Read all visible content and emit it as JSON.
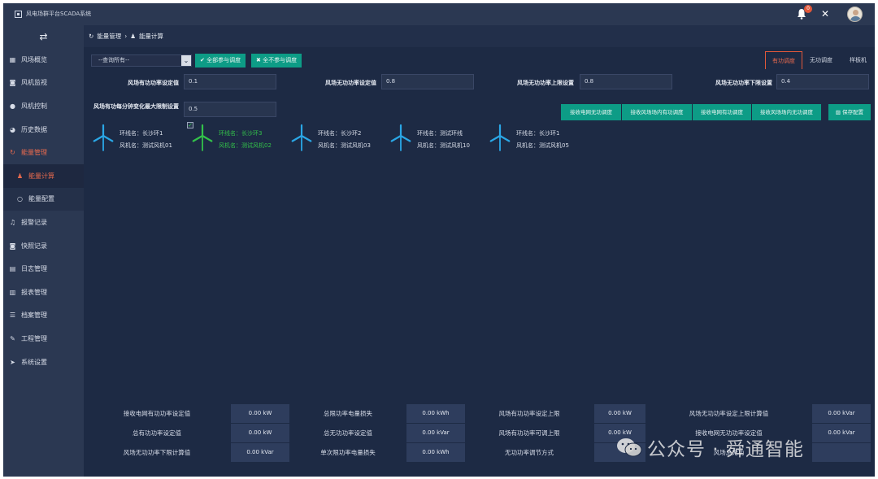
{
  "app": {
    "title": "风电场群平台SCADA系统",
    "notification_count": "0"
  },
  "sidebar": {
    "items": [
      {
        "label": "风场概览",
        "icon": "grid-icon"
      },
      {
        "label": "风机监视",
        "icon": "camera-icon"
      },
      {
        "label": "风机控制",
        "icon": "circle-icon"
      },
      {
        "label": "历史数据",
        "icon": "pie-icon"
      },
      {
        "label": "能量管理",
        "icon": "refresh-icon"
      },
      {
        "label": "能量计算",
        "icon": "user-icon"
      },
      {
        "label": "能量配置",
        "icon": "ring-icon"
      },
      {
        "label": "报警记录",
        "icon": "bell-icon"
      },
      {
        "label": "快照记录",
        "icon": "camera-icon"
      },
      {
        "label": "日志管理",
        "icon": "file-icon"
      },
      {
        "label": "报表管理",
        "icon": "table-icon"
      },
      {
        "label": "档案管理",
        "icon": "list-icon"
      },
      {
        "label": "工程管理",
        "icon": "wrench-icon"
      },
      {
        "label": "系统设置",
        "icon": "send-icon"
      }
    ]
  },
  "breadcrumb": {
    "parent": "能量管理",
    "separator": "›",
    "current": "能量计算"
  },
  "toolbar": {
    "select_value": "--查询所有--",
    "btn_all_join": "全部参与调度",
    "btn_all_exclude": "全不参与调度",
    "tabs": [
      "有功调度",
      "无功调度",
      "样板机"
    ]
  },
  "params": {
    "p1_label": "风场有功功率设定值",
    "p1_value": "0.1",
    "p2_label": "风场无功功率设定值",
    "p2_value": "0.8",
    "p3_label": "风场无功功率上限设置",
    "p3_value": "0.8",
    "p4_label": "风场无功功率下限设置",
    "p4_value": "0.4",
    "p5_label": "风场有功每分钟变化最大限制设置",
    "p5_value": "0.5"
  },
  "actions": {
    "a1": "接收电网无功调度",
    "a2": "接收风场场内有功调度",
    "a3": "接收电网有功调度",
    "a4": "接收风场场内无功调度",
    "save": "保存配置"
  },
  "turbines": [
    {
      "ring": "环线名：长沙环1",
      "name": "风机名：测试风机01",
      "status": "normal"
    },
    {
      "ring": "环线名：长沙环3",
      "name": "风机名：测试风机02",
      "status": "selected"
    },
    {
      "ring": "环线名：长沙环2",
      "name": "风机名：测试风机03",
      "status": "normal"
    },
    {
      "ring": "环线名：测试环线",
      "name": "风机名：测试风机10",
      "status": "normal"
    },
    {
      "ring": "环线名：长沙环1",
      "name": "风机名：测试风机05",
      "status": "normal"
    }
  ],
  "summary": {
    "r1": [
      {
        "label": "接收电网有功功率设定值",
        "value": "0.00 kW"
      },
      {
        "label": "总限功率电量损失",
        "value": "0.00 kWh"
      },
      {
        "label": "风场有功功率设定上限",
        "value": "0.00 kW"
      },
      {
        "label": "风场无功功率设定上限计算值",
        "value": "0.00 kVar"
      }
    ],
    "r2": [
      {
        "label": "总有功功率设定值",
        "value": "0.00 kW"
      },
      {
        "label": "总无功功率设定值",
        "value": "0.00 kVar"
      },
      {
        "label": "风场有功功率可调上限",
        "value": "0.00 kW"
      },
      {
        "label": "接收电网无功功率设定值",
        "value": "0.00 kVar"
      }
    ],
    "r3": [
      {
        "label": "风场无功功率下限计算值",
        "value": "0.00 kVar"
      },
      {
        "label": "单次限功率电量损失",
        "value": "0.00 kWh"
      },
      {
        "label": "无功功率调节方式",
        "value": ""
      },
      {
        "label": "风场总无功",
        "value": ""
      }
    ]
  },
  "watermark": {
    "text": "公众号 · 舜通智能"
  },
  "colors": {
    "accent": "#e86a4e",
    "teal": "#0d9c86",
    "bg": "#1d2a44",
    "panel": "#2b3852",
    "green": "#33c24a",
    "blue": "#2aa7e6"
  }
}
